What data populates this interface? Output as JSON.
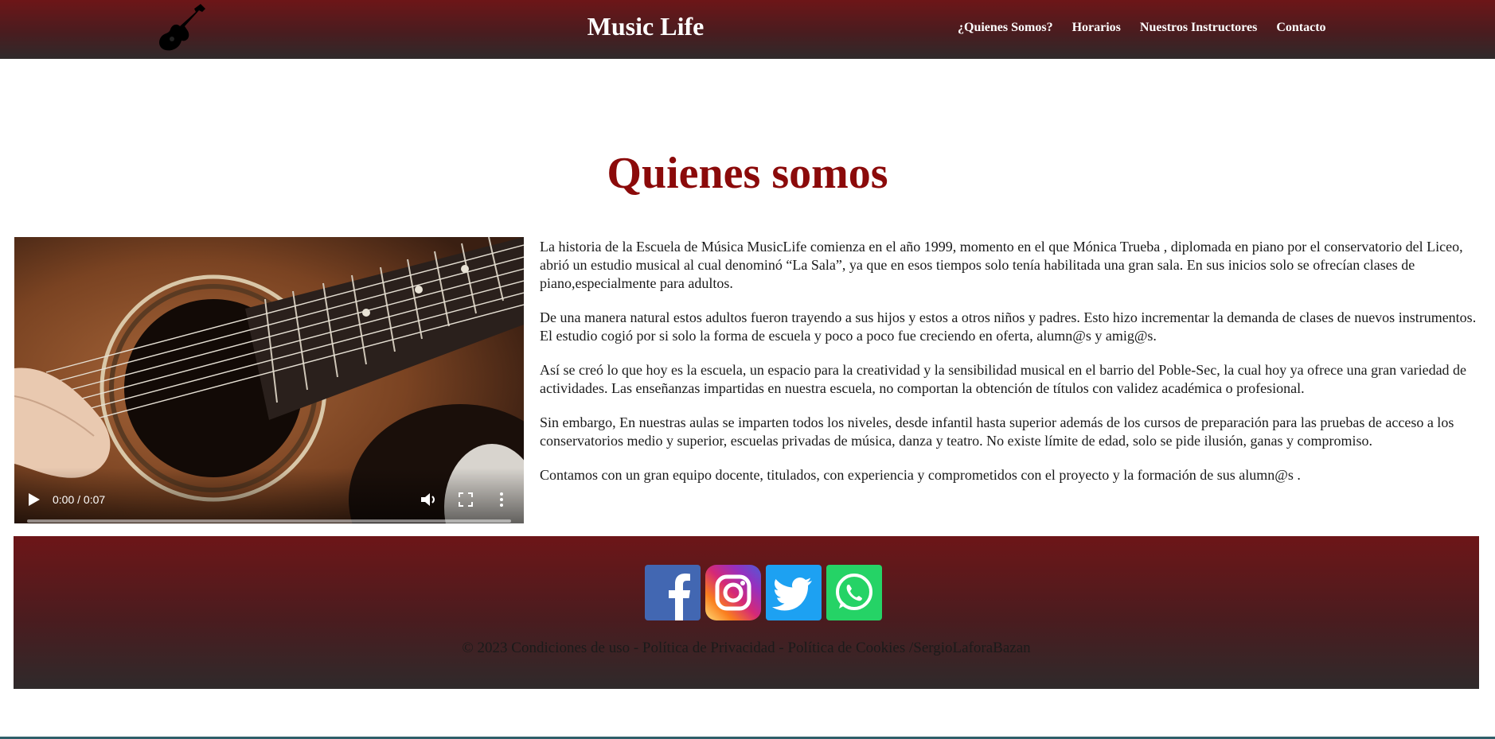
{
  "header": {
    "site_title": "Music Life",
    "logo_icon": "electric-guitar-icon",
    "nav": [
      {
        "label": "¿Quienes Somos?"
      },
      {
        "label": "Horarios"
      },
      {
        "label": "Nuestros Instructores"
      },
      {
        "label": "Contacto"
      }
    ]
  },
  "main": {
    "heading": "Quienes somos",
    "video": {
      "time": "0:00 / 0:07",
      "progress": 0
    },
    "paragraphs": [
      "La historia de la Escuela de Música MusicLife comienza en el año 1999, momento en el que Mónica Trueba , diplomada en piano por el conservatorio del Liceo, abrió un estudio musical al cual denominó “La Sala”, ya que en esos tiempos solo tenía habilitada una gran sala. En sus inicios solo se ofrecían clases de piano,especialmente para adultos.",
      "De una manera natural estos adultos fueron trayendo a sus hijos y estos a otros niños y padres. Esto hizo incrementar la demanda de clases de nuevos instrumentos. El estudio cogió por si solo la forma de escuela y poco a poco fue creciendo en oferta, alumn@s y amig@s.",
      "Así se creó lo que hoy es la escuela, un espacio para la creatividad y la sensibilidad musical en el barrio del Poble-Sec, la cual hoy ya ofrece una gran variedad de actividades. Las enseñanzas impartidas en nuestra escuela, no comportan la obtención de títulos con validez académica o profesional.",
      "Sin embargo, En nuestras aulas se imparten todos los niveles, desde infantil hasta superior además de los cursos de preparación para las pruebas de acceso a los conservatorios medio y superior, escuelas privadas de música, danza y teatro. No existe límite de edad, solo se pide ilusión, ganas y compromiso.",
      "Contamos con un gran equipo docente, titulados, con experiencia y comprometidos con el proyecto y la formación de sus alumn@s ."
    ]
  },
  "footer": {
    "social": [
      "facebook-icon",
      "instagram-icon",
      "twitter-icon",
      "whatsapp-icon"
    ],
    "copyright": "© 2023 Condiciones de uso - Política de Privacidad - Política de Cookies /SergioLaforaBazan"
  },
  "colors": {
    "header_gradient_top": "#6d1618",
    "header_gradient_bottom": "#2f2a2b",
    "heading": "#8b0a0a",
    "facebook": "#4267b2",
    "twitter": "#1da1f2",
    "whatsapp": "#25d366"
  }
}
